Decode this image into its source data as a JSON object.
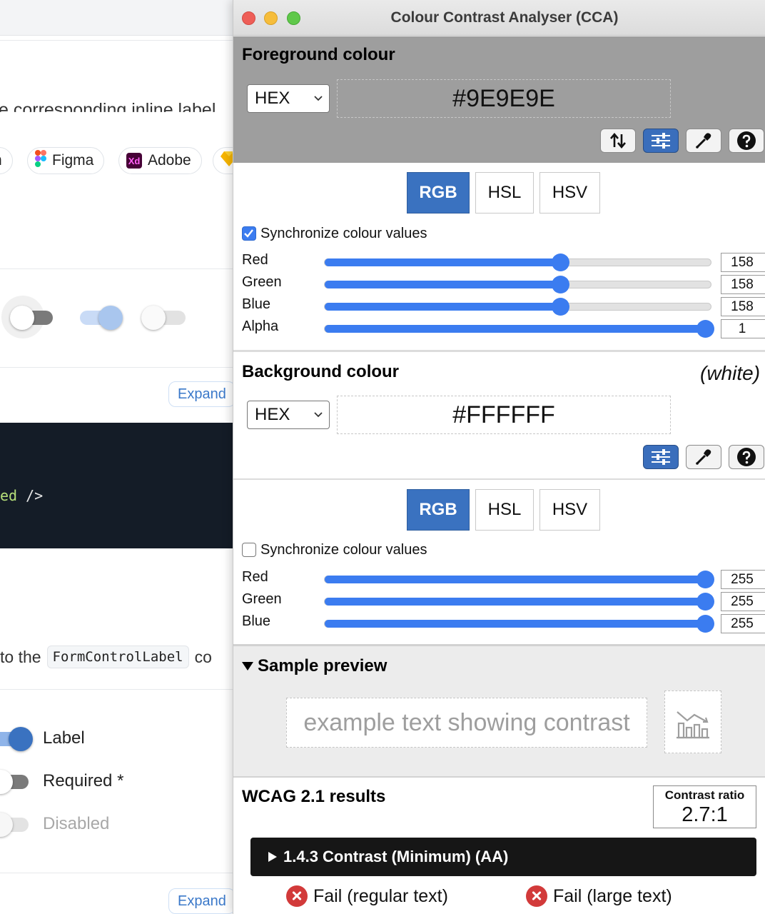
{
  "background_page": {
    "cut_text": "e corresponding inline label.",
    "chips": [
      {
        "label": "n"
      },
      {
        "label": "Figma"
      },
      {
        "label": "Adobe",
        "icon_text": "Xd"
      }
    ],
    "expand_label": "Expand",
    "code_tail": "ed",
    "code_end": "/>",
    "prefix_text": "to the",
    "inline_code": "FormControlLabel",
    "suffix_text": "co",
    "switch_labels": {
      "label": "Label",
      "required": "Required *",
      "disabled": "Disabled"
    }
  },
  "window": {
    "title": "Colour Contrast Analyser (CCA)"
  },
  "foreground": {
    "section_title": "Foreground colour",
    "format": "HEX",
    "hex": "#9E9E9E",
    "color": "#9e9e9e",
    "tabs": [
      "RGB",
      "HSL",
      "HSV"
    ],
    "active_tab": "RGB",
    "sync_label": "Synchronize colour values",
    "sync_checked": true,
    "channels": [
      {
        "label": "Red",
        "value": "158",
        "fraction": 0.62
      },
      {
        "label": "Green",
        "value": "158",
        "fraction": 0.62
      },
      {
        "label": "Blue",
        "value": "158",
        "fraction": 0.62
      },
      {
        "label": "Alpha",
        "value": "1",
        "fraction": 1.0
      }
    ],
    "tools": [
      "swap-icon",
      "sliders-icon",
      "eyedropper-icon",
      "help-icon"
    ]
  },
  "background": {
    "section_title": "Background colour",
    "name": "(white)",
    "format": "HEX",
    "hex": "#FFFFFF",
    "color": "#ffffff",
    "tabs": [
      "RGB",
      "HSL",
      "HSV"
    ],
    "active_tab": "RGB",
    "sync_label": "Synchronize colour values",
    "sync_checked": false,
    "channels": [
      {
        "label": "Red",
        "value": "255",
        "fraction": 1.0
      },
      {
        "label": "Green",
        "value": "255",
        "fraction": 1.0
      },
      {
        "label": "Blue",
        "value": "255",
        "fraction": 1.0
      }
    ],
    "tools": [
      "sliders-icon",
      "eyedropper-icon",
      "help-icon"
    ]
  },
  "preview": {
    "title": "Sample preview",
    "sample_text": "example text showing contrast"
  },
  "results": {
    "title": "WCAG 2.1 results",
    "ratio_label": "Contrast ratio",
    "ratio_value": "2.7:1",
    "criterion": "1.4.3 Contrast (Minimum) (AA)",
    "regular": "Fail (regular text)",
    "large": "Fail (large text)"
  },
  "colors": {
    "accent": "#3a72c0",
    "slider": "#3b7cf0",
    "fail": "#d23a3a"
  }
}
